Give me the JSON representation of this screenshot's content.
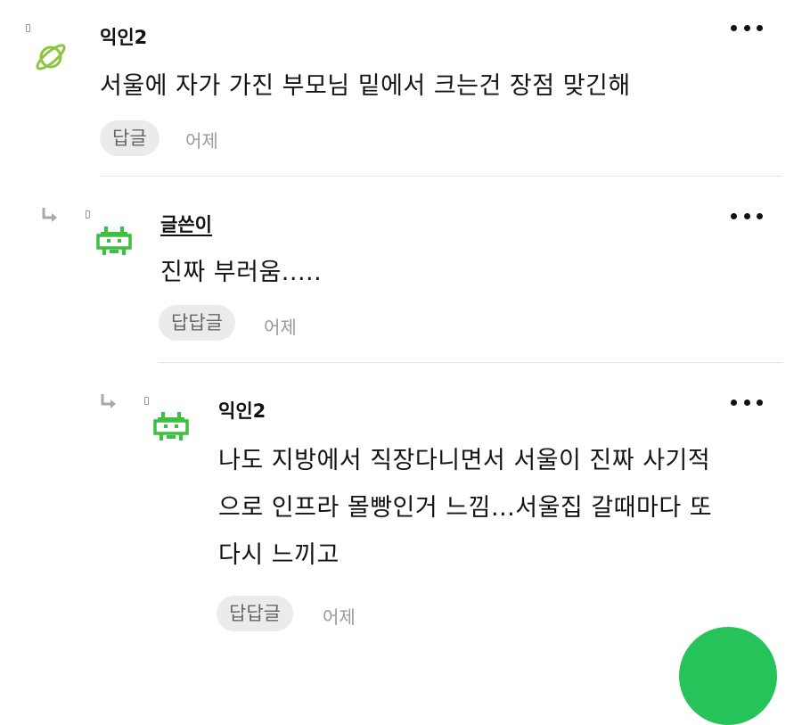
{
  "comments": [
    {
      "author": "익인2",
      "text": "서울에 자가 가진 부모님 밑에서 크는건 장점 맞긴해",
      "reply_label": "답글",
      "time": "어제",
      "avatar_icon": "planet-icon"
    },
    {
      "author": "글쓴이",
      "text": "진짜 부러움.....",
      "reply_label": "답답글",
      "time": "어제",
      "avatar_icon": "space-invader-icon"
    },
    {
      "author": "익인2",
      "text_lines": [
        "나도 지방에서 직장다니면서 서울이 진짜 사기적",
        "으로 인프라 몰빵인거 느낌...서울집 갈때마다 또",
        "다시 느끼고"
      ],
      "reply_label": "답답글",
      "time": "어제",
      "avatar_icon": "space-invader-icon"
    }
  ],
  "colors": {
    "planet": "#8cc63f",
    "invader": "#3fbf3f",
    "fab": "#25c35a"
  }
}
